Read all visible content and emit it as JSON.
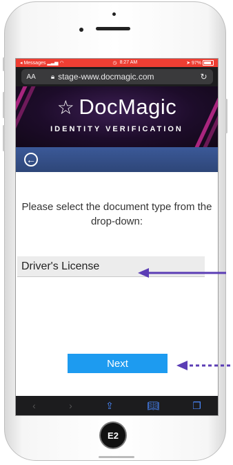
{
  "status_bar": {
    "back_app": "◂ Messages",
    "time": "8:27 AM",
    "battery": "97%"
  },
  "browser": {
    "text_size": "AA",
    "url": "stage-www.docmagic.com",
    "reload_icon": "reload-icon"
  },
  "banner": {
    "brand": "DocMagic",
    "subtitle": "IDENTITY VERIFICATION"
  },
  "navbar": {
    "back_icon": "back-circle-icon"
  },
  "content": {
    "prompt": "Please select the document type from the drop-down:",
    "document_type": "Driver's License",
    "next_label": "Next"
  },
  "toolbar": {
    "back": "‹",
    "forward": "›",
    "share": "share-icon",
    "bookmarks": "book-icon",
    "tabs": "tabs-icon"
  },
  "device": {
    "home_badge": "E2"
  },
  "colors": {
    "status_red": "#ee3e33",
    "nav_blue": "#2e4678",
    "button_blue": "#1d9bf0",
    "callout_purple": "#5b3db5",
    "banner_purple": "#1d0c2a"
  }
}
